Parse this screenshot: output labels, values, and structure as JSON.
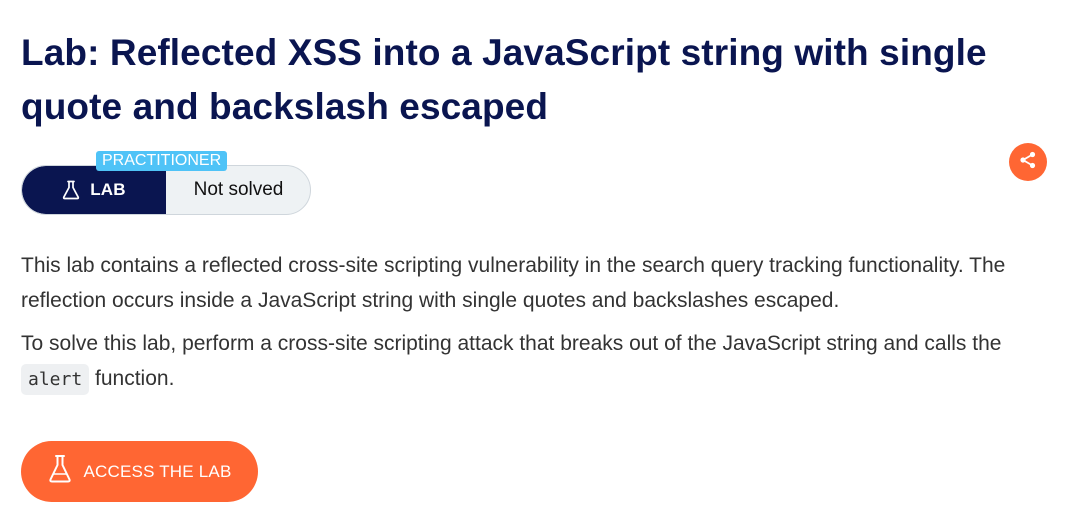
{
  "lab": {
    "title": "Lab: Reflected XSS into a JavaScript string with single quote and backslash escaped",
    "level": "PRACTITIONER",
    "badge_label": "LAB",
    "status": "Not solved"
  },
  "description": {
    "paragraph1": "This lab contains a reflected cross-site scripting vulnerability in the search query tracking functionality. The reflection occurs inside a JavaScript string with single quotes and backslashes escaped.",
    "paragraph2_before": "To solve this lab, perform a cross-site scripting attack that breaks out of the JavaScript string and calls the ",
    "paragraph2_code": "alert",
    "paragraph2_after": " function."
  },
  "actions": {
    "access_label": "ACCESS THE LAB"
  },
  "icons": {
    "share": "share-icon",
    "flask": "flask-icon"
  },
  "colors": {
    "title": "#0a1550",
    "accent": "#ff6633",
    "level_tag": "#4fc3f7",
    "badge_dark": "#0a1550"
  }
}
